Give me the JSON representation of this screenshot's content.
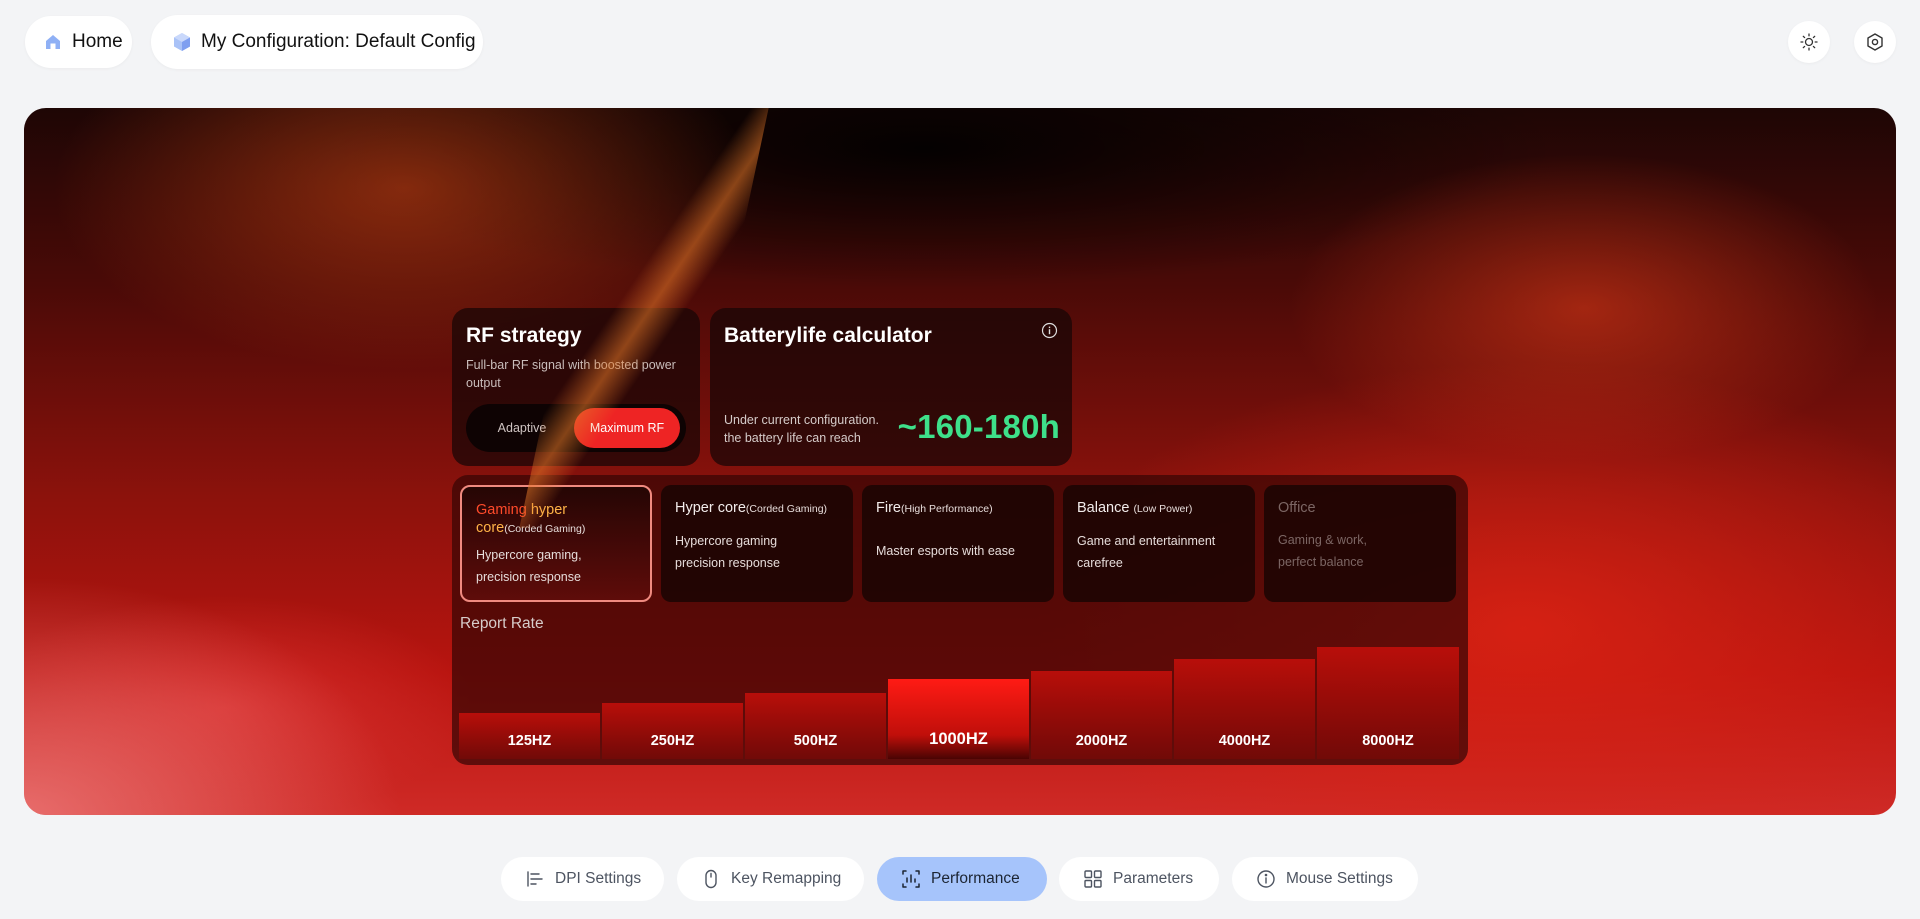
{
  "header": {
    "home_label": "Home",
    "config_label": "My Configuration: Default Config",
    "icons": [
      "home-icon",
      "cube-icon",
      "sun-icon",
      "hexagon-settings-icon"
    ]
  },
  "rf_strategy": {
    "title": "RF strategy",
    "description": "Full-bar RF signal with boosted power output",
    "options": [
      "Adaptive",
      "Maximum RF"
    ],
    "selected": "Maximum RF"
  },
  "battery": {
    "title": "Batterylife calculator",
    "subtitle_line1": "Under current configuration.",
    "subtitle_line2": "the battery life can reach",
    "value": "~160-180h"
  },
  "modes": [
    {
      "name_part1": "Gaming ",
      "name_part2": "hyper core",
      "tag": "(Corded Gaming)",
      "desc_line1": "Hypercore gaming,",
      "desc_line2": "precision response",
      "active": true
    },
    {
      "name": "Hyper core",
      "tag": "(Corded Gaming)",
      "desc_line1": "Hypercore gaming",
      "desc_line2": "precision response"
    },
    {
      "name": "Fire",
      "tag": "(High Performance)",
      "desc_line1": "Master esports with ease",
      "desc_line2": ""
    },
    {
      "name": "Balance ",
      "tag": "(Low Power)",
      "desc_line1": "Game and entertainment",
      "desc_line2": "carefree"
    },
    {
      "name": "Office",
      "tag": "",
      "desc_line1": "Gaming & work,",
      "desc_line2": "perfect balance",
      "disabled": true
    }
  ],
  "report_rate": {
    "label": "Report Rate",
    "rates": [
      "125HZ",
      "250HZ",
      "500HZ",
      "1000HZ",
      "2000HZ",
      "4000HZ",
      "8000HZ"
    ],
    "selected": "1000HZ"
  },
  "bottom_nav": {
    "items": [
      "DPI Settings",
      "Key Remapping",
      "Performance",
      "Parameters",
      "Mouse Settings"
    ],
    "selected": "Performance"
  },
  "colors": {
    "accent_red": "#ee2424",
    "battery_green": "#3ee08a",
    "nav_active": "#a6c4fb"
  }
}
